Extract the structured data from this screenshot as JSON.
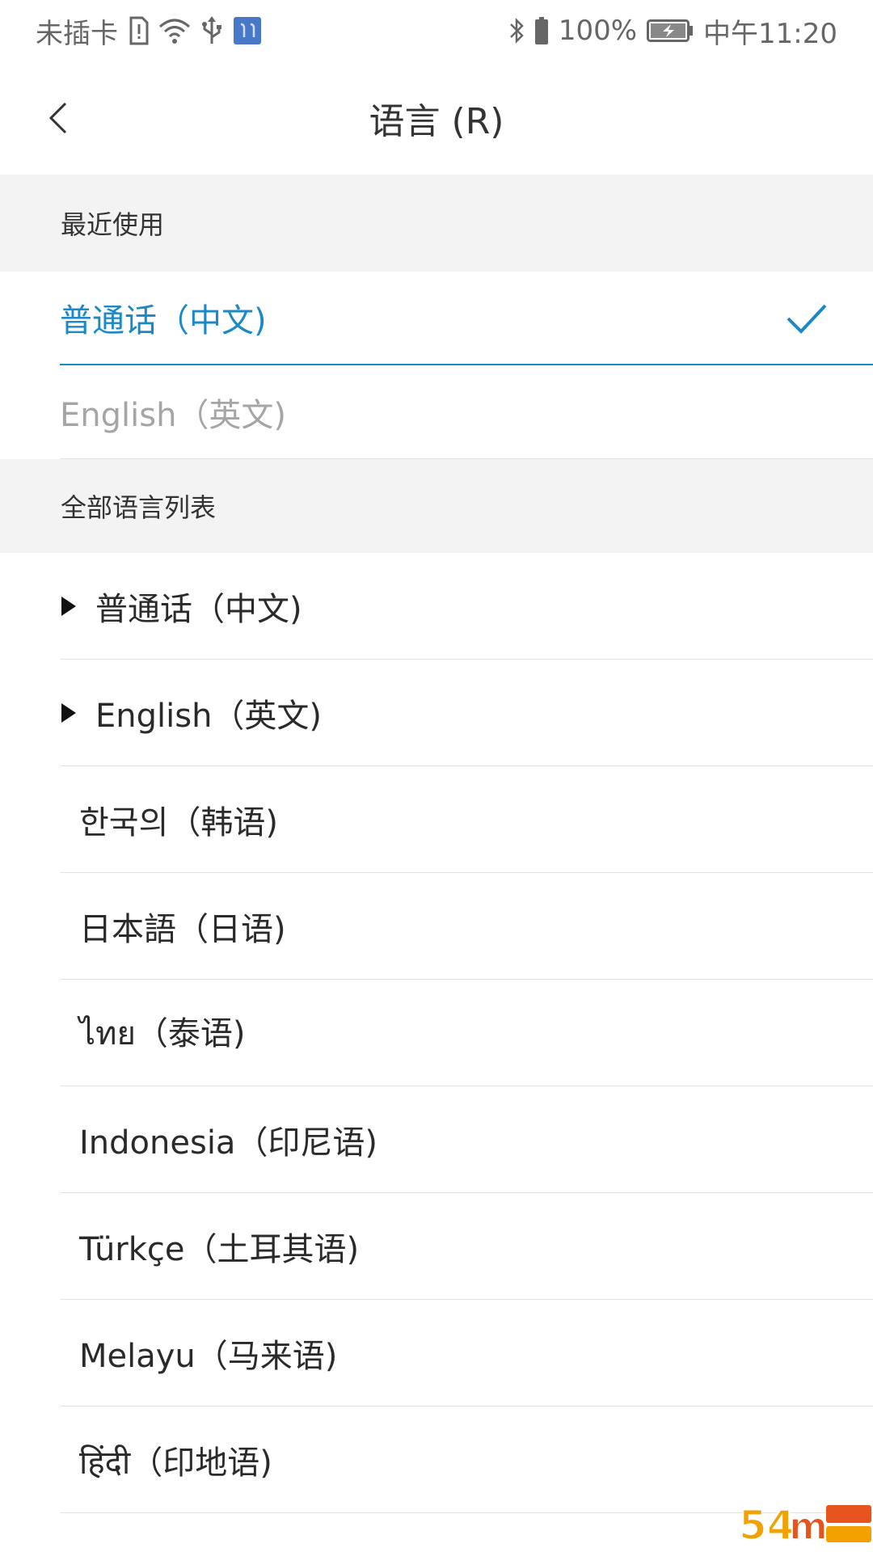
{
  "status_bar": {
    "carrier": "未插卡",
    "battery_percent": "100%",
    "time": "中午11:20"
  },
  "header": {
    "title": "语言 (R)"
  },
  "recent": {
    "section_title": "最近使用",
    "items": [
      {
        "label": "普通话（中文)",
        "selected": true
      },
      {
        "label": "English（英文)",
        "selected": false
      }
    ]
  },
  "all_languages": {
    "section_title": "全部语言列表",
    "items": [
      {
        "label": "普通话（中文)",
        "expandable": true
      },
      {
        "label": "English（英文)",
        "expandable": true
      },
      {
        "label": "한국의（韩语)",
        "expandable": false
      },
      {
        "label": "日本語（日语)",
        "expandable": false
      },
      {
        "label": "ไทย（泰语)",
        "expandable": false
      },
      {
        "label": "Indonesia（印尼语)",
        "expandable": false
      },
      {
        "label": "Türkçe（土耳其语)",
        "expandable": false
      },
      {
        "label": "Melayu（马来语)",
        "expandable": false
      },
      {
        "label": "हिंदी（印地语)",
        "expandable": false
      }
    ]
  },
  "colors": {
    "accent": "#1b88c8",
    "section_bg": "#f3f3f3",
    "divider": "#e3e3e3"
  },
  "icons": {
    "back": "chevron-left-icon",
    "selected": "check-icon",
    "expand": "triangle-right-icon"
  }
}
